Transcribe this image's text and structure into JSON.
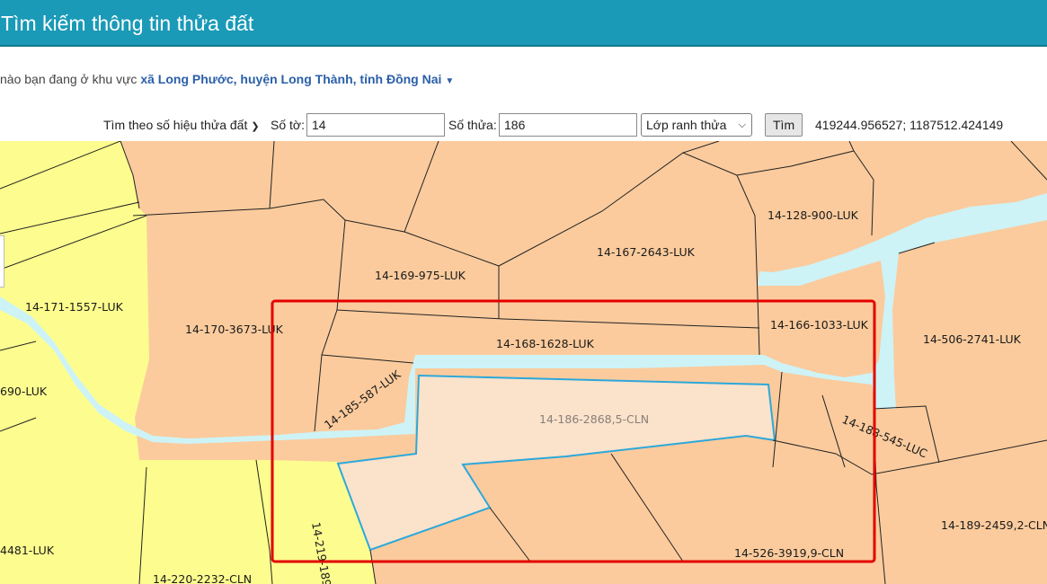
{
  "header": {
    "title": "Tìm kiếm thông tin thửa đất"
  },
  "location": {
    "prefix": "nào bạn đang ở khu vực",
    "region": "xã Long Phước, huyện Long Thành, tỉnh Đồng Nai"
  },
  "search": {
    "mode": "Tìm theo số hiệu thửa đất",
    "sheet_label": "Số tờ:",
    "sheet_value": "14",
    "parcel_label": "Số thửa:",
    "parcel_value": "186",
    "layer": "Lớp ranh thửa",
    "button": "Tìm",
    "coords": "419244.956527; 1187512.424149"
  },
  "map": {
    "colors": {
      "luk": "#fbcb9d",
      "cln_yellow": "#fdfd8f",
      "river": "#cdf3f7",
      "selected": "#fbe2cb",
      "selected_border": "#2ca8da",
      "highlight": "#e30000"
    },
    "parcels": [
      "14-171-1557-LUK",
      "14-170-3673-LUK",
      "14-169-975-LUK",
      "14-167-2643-LUK",
      "14-128-900-LUK",
      "14-166-1033-LUK",
      "14-168-1628-LUK",
      "14-506-2741-LUK",
      "690-LUK",
      "14-185-587-LUK",
      "14-186-2868,5-CLN",
      "14-188-545-LUC",
      "14-189-2459,2-CLN",
      "4481-LUK",
      "14-219-189",
      "14-220-2232-CLN",
      "14-526-3919,9-CLN"
    ]
  }
}
